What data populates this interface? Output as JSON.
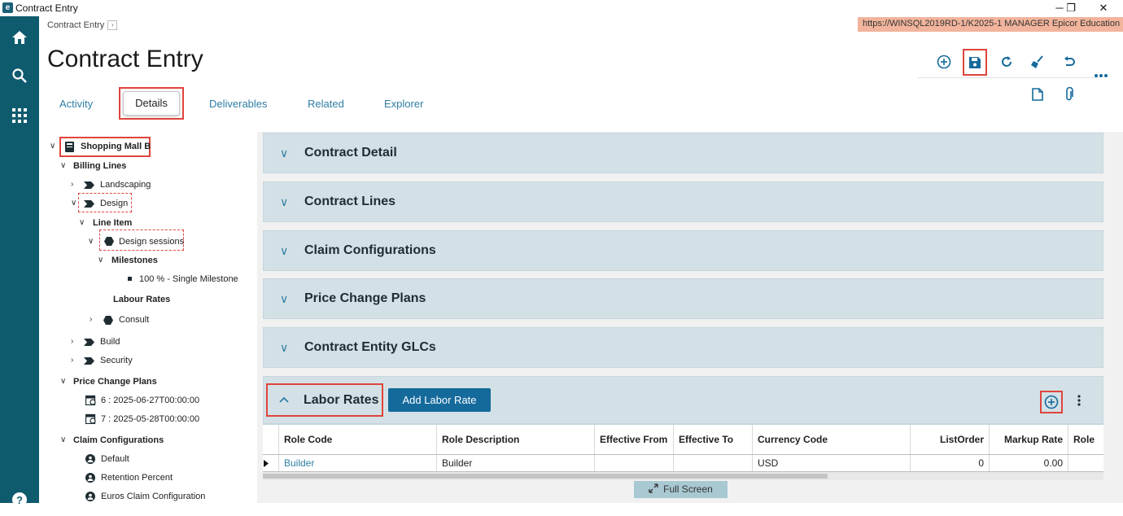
{
  "window": {
    "title": "Contract Entry",
    "minimize": "─",
    "restore": "❐",
    "close": "✕"
  },
  "breadcrumb": {
    "label": "Contract Entry",
    "chevron": "›"
  },
  "environment": {
    "text": "https://WINSQL2019RD-1/K2025-1   MANAGER   Epicor Education"
  },
  "page": {
    "title": "Contract Entry"
  },
  "tabs": [
    {
      "label": "Activity"
    },
    {
      "label": "Details"
    },
    {
      "label": "Deliverables"
    },
    {
      "label": "Related"
    },
    {
      "label": "Explorer"
    }
  ],
  "tree": {
    "root": "Shopping Mall B",
    "billing_lines": "Billing Lines",
    "landscaping": "Landscaping",
    "design": "Design",
    "line_item": "Line Item",
    "design_sessions": "Design sessions",
    "milestones": "Milestones",
    "milestone_item": "100 % - Single Milestone",
    "labour_rates": "Labour Rates",
    "consult": "Consult",
    "build": "Build",
    "security": "Security",
    "price_change_plans": "Price Change Plans",
    "pcp_6": "6 : 2025-06-27T00:00:00",
    "pcp_7": "7 : 2025-05-28T00:00:00",
    "claim_configurations": "Claim Configurations",
    "claim_default": "Default",
    "claim_retention": "Retention Percent",
    "claim_euros": "Euros Claim Configuration"
  },
  "sections": [
    {
      "label": "Contract Detail"
    },
    {
      "label": "Contract Lines"
    },
    {
      "label": "Claim Configurations"
    },
    {
      "label": "Price Change Plans"
    },
    {
      "label": "Contract Entity GLCs"
    }
  ],
  "labor": {
    "title": "Labor Rates",
    "add_button": "Add Labor Rate",
    "columns": [
      "Role Code",
      "Role Description",
      "Effective From",
      "Effective To",
      "Currency Code",
      "ListOrder",
      "Markup Rate",
      "Role"
    ],
    "rows": [
      {
        "role_code": "Builder",
        "role_description": "Builder",
        "effective_from": "",
        "effective_to": "",
        "currency_code": "USD",
        "list_order": "0",
        "markup_rate": "0.00"
      }
    ],
    "full_screen": "Full Screen"
  },
  "colors": {
    "rail": "#0f5b6e",
    "accent": "#156a9c",
    "section_bg": "#d3e1e6",
    "highlight": "#e0443c"
  }
}
